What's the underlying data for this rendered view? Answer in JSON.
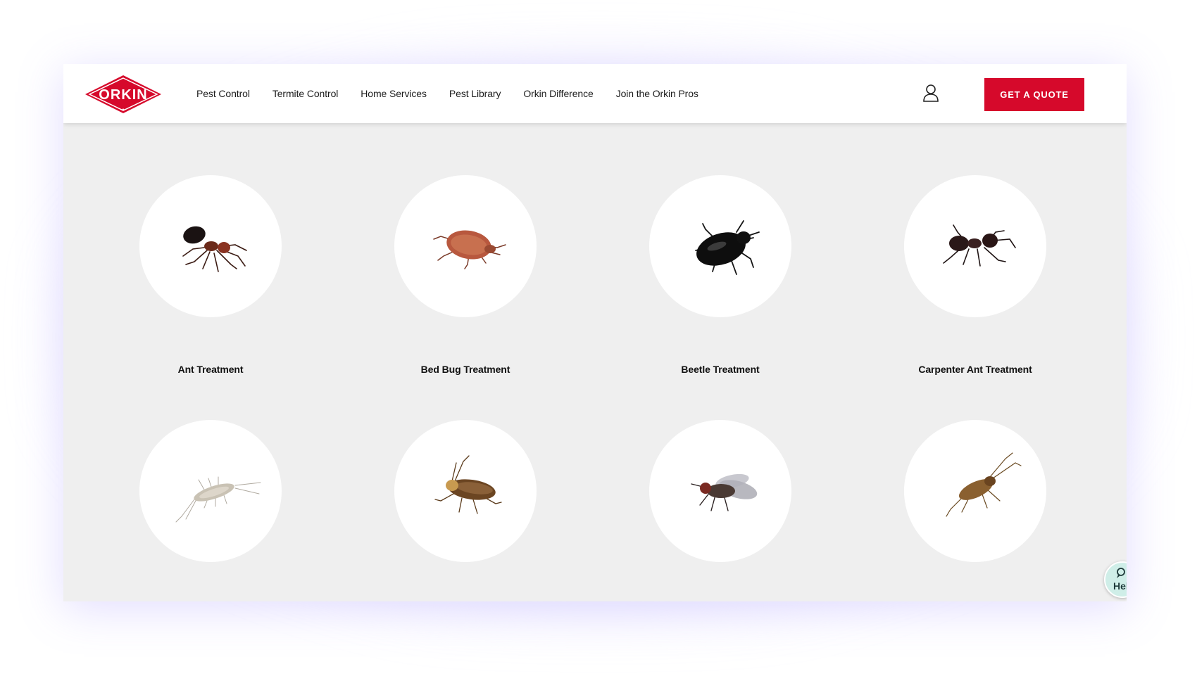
{
  "brand": {
    "name": "ORKIN",
    "color": "#d6092b"
  },
  "nav": {
    "items": [
      {
        "label": "Pest Control"
      },
      {
        "label": "Termite Control"
      },
      {
        "label": "Home Services"
      },
      {
        "label": "Pest Library"
      },
      {
        "label": "Orkin Difference"
      },
      {
        "label": "Join the Orkin Pros"
      }
    ]
  },
  "header": {
    "account_icon": "user-icon",
    "quote_label": "GET A QUOTE"
  },
  "treatments": [
    {
      "label": "Ant Treatment",
      "icon": "ant-icon"
    },
    {
      "label": "Bed Bug Treatment",
      "icon": "bed-bug-icon"
    },
    {
      "label": "Beetle Treatment",
      "icon": "beetle-icon"
    },
    {
      "label": "Carpenter Ant Treatment",
      "icon": "carpenter-ant-icon"
    },
    {
      "label": "",
      "icon": "silverfish-icon"
    },
    {
      "label": "",
      "icon": "cockroach-icon"
    },
    {
      "label": "",
      "icon": "fly-icon"
    },
    {
      "label": "",
      "icon": "cricket-icon"
    }
  ],
  "help": {
    "label": "Hel",
    "icon": "chat-person-icon"
  }
}
